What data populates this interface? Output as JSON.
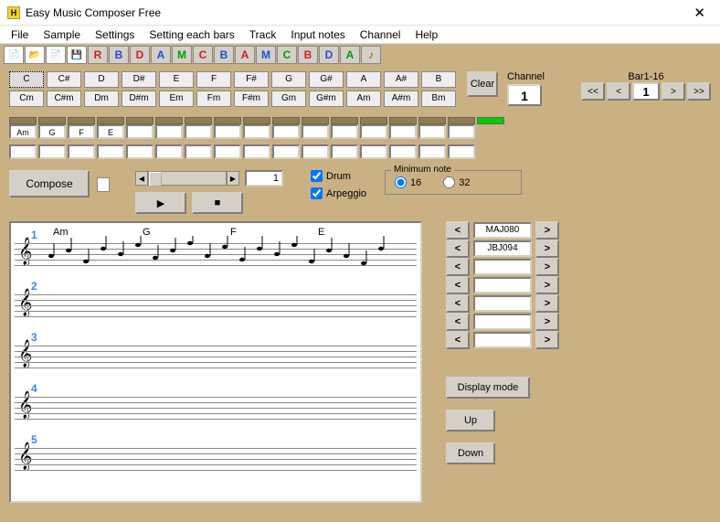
{
  "window": {
    "title": "Easy Music Composer Free"
  },
  "menu": [
    "File",
    "Sample",
    "Settings",
    "Setting each bars",
    "Track",
    "Input notes",
    "Channel",
    "Help"
  ],
  "toolbar_files": [
    "📄",
    "📂",
    "📄",
    "💾"
  ],
  "toolbar_letters": [
    {
      "t": "R",
      "c": "#d02020"
    },
    {
      "t": "B",
      "c": "#2050d0"
    },
    {
      "t": "D",
      "c": "#d02020"
    },
    {
      "t": "A",
      "c": "#2050d0"
    },
    {
      "t": "M",
      "c": "#00a000"
    },
    {
      "t": "C",
      "c": "#d02020"
    },
    {
      "t": "B",
      "c": "#2050d0"
    },
    {
      "t": "A",
      "c": "#d02020"
    },
    {
      "t": "M",
      "c": "#2050d0"
    },
    {
      "t": "C",
      "c": "#00a000"
    },
    {
      "t": "B",
      "c": "#d02020"
    },
    {
      "t": "D",
      "c": "#2050d0"
    },
    {
      "t": "A",
      "c": "#00a000"
    },
    {
      "t": "♪",
      "c": "#886600"
    }
  ],
  "chords_major": [
    "C",
    "C#",
    "D",
    "D#",
    "E",
    "F",
    "F#",
    "G",
    "G#",
    "A",
    "A#",
    "B"
  ],
  "chords_minor": [
    "Cm",
    "C#m",
    "Dm",
    "D#m",
    "Em",
    "Fm",
    "F#m",
    "Gm",
    "G#m",
    "Am",
    "A#m",
    "Bm"
  ],
  "clear_label": "Clear",
  "channel": {
    "label": "Channel",
    "value": "1"
  },
  "barnav": {
    "label": "Bar1-16",
    "first": "<<",
    "prev": "<",
    "value": "1",
    "next": ">",
    "last": ">>"
  },
  "slots": [
    "Am",
    "G",
    "F",
    "E",
    "",
    "",
    "",
    "",
    "",
    "",
    "",
    "",
    "",
    "",
    "",
    ""
  ],
  "spin_value": "1",
  "compose_label": "Compose",
  "drum_label": "Drum",
  "arpeggio_label": "Arpeggio",
  "minimum": {
    "legend": "Minimum note",
    "opt1": "16",
    "opt2": "32"
  },
  "score_chords": [
    "Am",
    "G",
    "F",
    "E"
  ],
  "patterns": [
    "MAJ080",
    "JBJ094",
    "",
    "",
    "",
    "",
    ""
  ],
  "display_mode": "Display mode",
  "up": "Up",
  "down": "Down"
}
